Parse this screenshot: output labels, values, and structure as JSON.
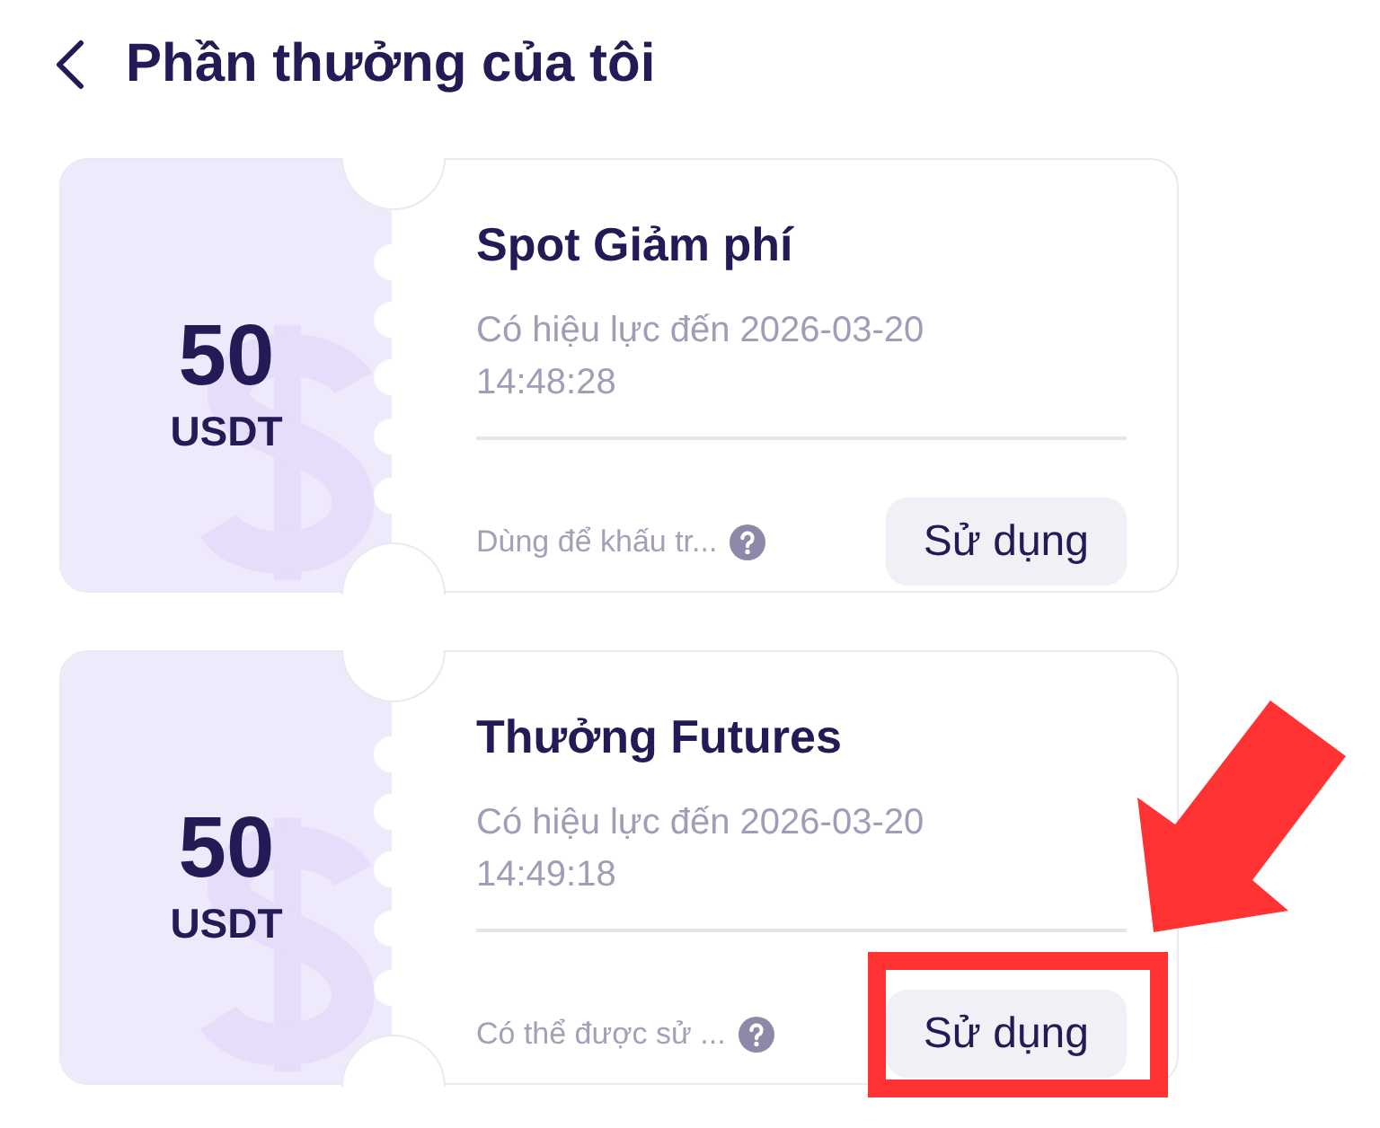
{
  "header": {
    "title": "Phần thưởng của tôi"
  },
  "coupons": [
    {
      "amount": "50",
      "unit": "USDT",
      "title": "Spot Giảm phí",
      "validity": "Có hiệu lực đến 2026-03-20 14:48:28",
      "note": "Dùng để khấu tr...",
      "button": "Sử dụng",
      "highlighted": false
    },
    {
      "amount": "50",
      "unit": "USDT",
      "title": "Thưởng Futures",
      "validity": "Có hiệu lực đến 2026-03-20 14:49:18",
      "note": "Có thể được sử ...",
      "button": "Sử dụng",
      "highlighted": true
    }
  ]
}
